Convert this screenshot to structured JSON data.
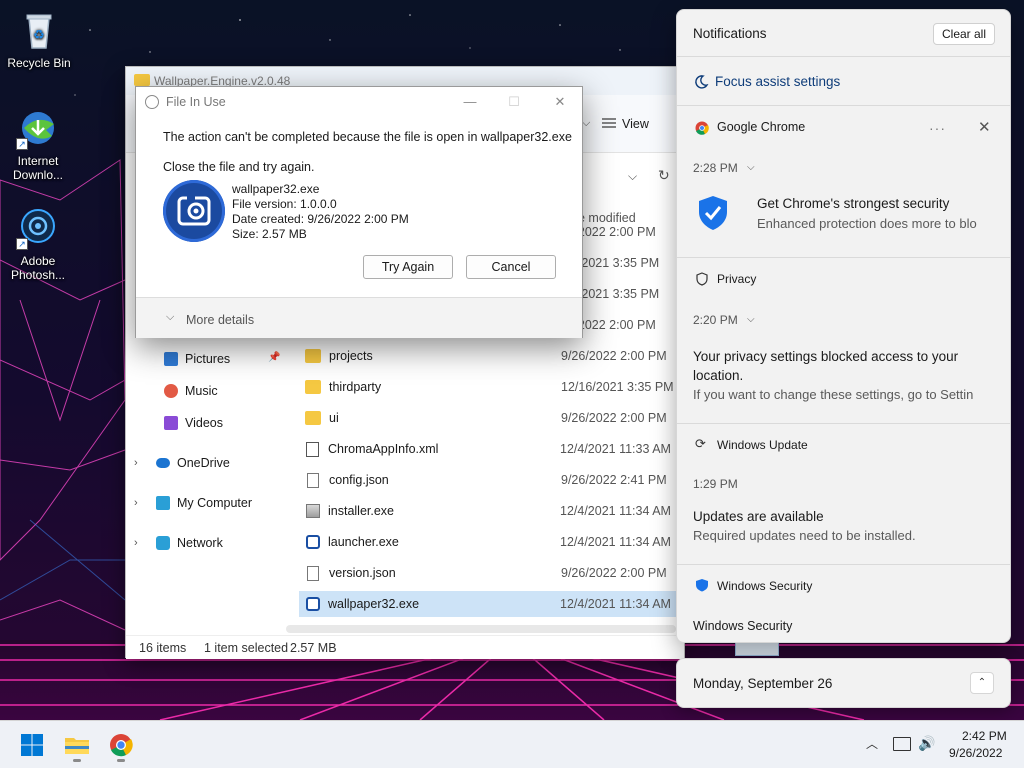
{
  "desktop": {
    "icons": [
      {
        "label": "Recycle Bin",
        "icon": "recycle-bin-icon"
      },
      {
        "label": "Internet Downlo...",
        "icon": "internet-download-manager-icon"
      },
      {
        "label": "Adobe Photosh...",
        "icon": "adobe-photoshop-icon"
      }
    ]
  },
  "explorer": {
    "title": "Wallpaper.Engine.v2.0.48",
    "view_label": "View",
    "column_modified": "e modified",
    "nav": [
      {
        "label": "Pictures",
        "icon": "pictures-icon",
        "color": "#2f7bd6"
      },
      {
        "label": "Music",
        "icon": "music-icon",
        "color": "#e25a45"
      },
      {
        "label": "Videos",
        "icon": "videos-icon",
        "color": "#8a4bd6"
      },
      {
        "label": "OneDrive",
        "icon": "onedrive-icon",
        "color": "#1b74d1"
      },
      {
        "label": "My Computer",
        "icon": "computer-icon",
        "color": "#2a9fd6"
      },
      {
        "label": "Network",
        "icon": "network-icon",
        "color": "#2a9fd6"
      }
    ],
    "partial_dates": [
      "/6/2022 2:00 PM",
      "16/2021 3:35 PM",
      "16/2021 3:35 PM",
      "/6/2022 2:00 PM"
    ],
    "files": [
      {
        "name": "projects",
        "date": "9/26/2022 2:00 PM",
        "type": "folder"
      },
      {
        "name": "thirdparty",
        "date": "12/16/2021 3:35 PM",
        "type": "folder"
      },
      {
        "name": "ui",
        "date": "9/26/2022 2:00 PM",
        "type": "folder"
      },
      {
        "name": "ChromaAppInfo.xml",
        "date": "12/4/2021 11:33 AM",
        "type": "xml"
      },
      {
        "name": "config.json",
        "date": "9/26/2022 2:41 PM",
        "type": "doc"
      },
      {
        "name": "installer.exe",
        "date": "12/4/2021 11:34 AM",
        "type": "inst"
      },
      {
        "name": "launcher.exe",
        "date": "12/4/2021 11:34 AM",
        "type": "exe"
      },
      {
        "name": "version.json",
        "date": "9/26/2022 2:00 PM",
        "type": "doc"
      },
      {
        "name": "wallpaper32.exe",
        "date": "12/4/2021 11:34 AM",
        "type": "exe",
        "selected": true
      }
    ],
    "status": {
      "items": "16 items",
      "selected": "1 item selected",
      "size": "2.57 MB"
    }
  },
  "dialog": {
    "title": "File In Use",
    "message": "The action can't be completed because the file is open in wallpaper32.exe",
    "instruction": "Close the file and try again.",
    "file_name": "wallpaper32.exe",
    "file_version": "File version: 1.0.0.0",
    "date_created": "Date created: 9/26/2022 2:00 PM",
    "size": "Size: 2.57 MB",
    "try_again": "Try Again",
    "cancel": "Cancel",
    "more_details": "More details"
  },
  "notifications": {
    "title": "Notifications",
    "clear_all": "Clear all",
    "focus_assist": "Focus assist settings",
    "items": [
      {
        "app": "Google Chrome",
        "time": "2:28 PM",
        "heading": "Get Chrome's strongest security",
        "body": "Enhanced protection does more to blo"
      },
      {
        "app": "Privacy",
        "time": "2:20 PM",
        "heading": "Your privacy settings blocked access to your",
        "heading2": "location.",
        "body": "If you want to change these settings, go to Settin"
      },
      {
        "app": "Windows Update",
        "time": "1:29 PM",
        "heading": "Updates are available",
        "body": "Required updates need to be installed."
      },
      {
        "app": "Windows Security",
        "heading": "Windows Security"
      }
    ],
    "date": "Monday, September 26"
  },
  "taskbar": {
    "time": "2:42 PM",
    "date": "9/26/2022"
  },
  "colors": {
    "accent": "#0067c0",
    "selection": "#cde3f7",
    "desktop_grid": "#ff2fb4"
  }
}
